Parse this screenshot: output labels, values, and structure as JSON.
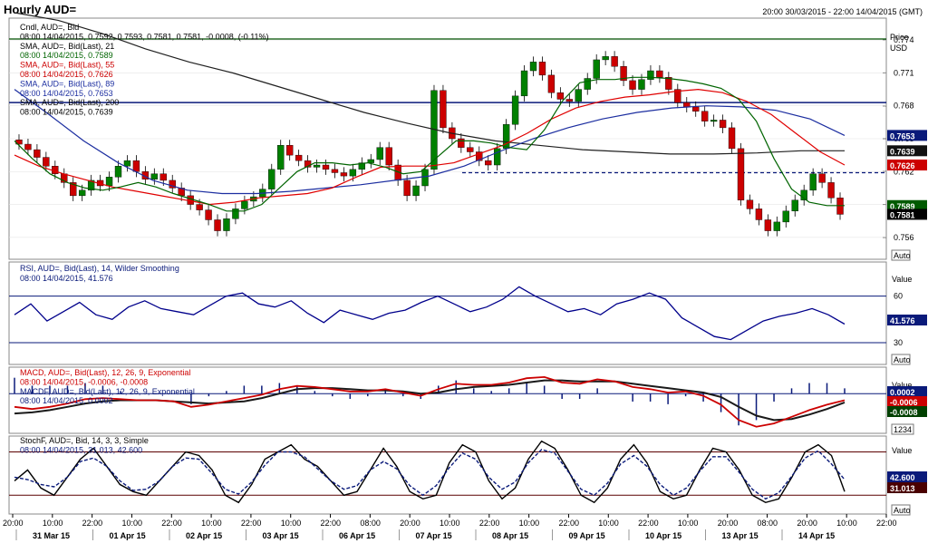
{
  "header": {
    "title": "Hourly AUD=",
    "range": "20:00 30/03/2015 - 22:00 14/04/2015 (GMT)"
  },
  "colors": {
    "bull": "#008000",
    "bear": "#cc0000",
    "sma21": "#006400",
    "sma55": "#e00000",
    "sma89": "#1c2ea0",
    "sma200": "#202020",
    "rsi": "#00008b",
    "navy": "#0a1a7a",
    "green_level": "#005000"
  },
  "price_panel": {
    "axis_title": "Price",
    "axis_unit": "USD",
    "legend": [
      {
        "text": "Cndl, AUD=, Bid",
        "color": "#000000"
      },
      {
        "text": "08:00 14/04/2015, 0.7592, 0.7593, 0.7581, 0.7581, -0.0008, (-0.11%)",
        "color": "#000000",
        "red_suffix": true
      },
      {
        "text": "SMA, AUD=, Bid(Last), 21",
        "color": "#000000"
      },
      {
        "text": "08:00 14/04/2015, 0.7589",
        "color": "#006400"
      },
      {
        "text": "SMA, AUD=, Bid(Last), 55",
        "color": "#cc0000"
      },
      {
        "text": "08:00 14/04/2015, 0.7626",
        "color": "#cc0000"
      },
      {
        "text": "SMA, AUD=, Bid(Last), 89",
        "color": "#1c2ea0"
      },
      {
        "text": "08:00 14/04/2015, 0.7653",
        "color": "#1c2ea0"
      },
      {
        "text": "SMA, AUD=, Bid(Last), 200",
        "color": "#000000"
      },
      {
        "text": "08:00 14/04/2015, 0.7639",
        "color": "#000000"
      }
    ],
    "ticks": [
      "0.774",
      "0.771",
      "0.768",
      "0.765",
      "0.762",
      "0.759",
      "0.756"
    ],
    "levels": {
      "resistance_1": 0.7741,
      "resistance_2": 0.7683,
      "dashed": 0.7619
    },
    "value_tags": [
      {
        "text": "0.7653",
        "value": 0.7653,
        "bg": "#0a1a7a"
      },
      {
        "text": "0.7639",
        "value": 0.7639,
        "bg": "#111111"
      },
      {
        "text": "0.7626",
        "value": 0.7626,
        "bg": "#cc0000"
      },
      {
        "text": "0.7589",
        "value": 0.7589,
        "bg": "#005a00"
      },
      {
        "text": "0.7581",
        "value": 0.7581,
        "bg": "#000000"
      }
    ],
    "auto_label": "Auto"
  },
  "rsi_panel": {
    "legend": [
      "RSI, AUD=, Bid(Last), 14, Wilder Smoothing",
      "08:00 14/04/2015, 41.576"
    ],
    "axis_title": "Value",
    "ticks": [
      "60",
      "30"
    ],
    "value_tag": "41.576",
    "auto_label": "Auto"
  },
  "macd_panel": {
    "legend": [
      {
        "text": "MACD, AUD=, Bid(Last), 12, 26, 9, Exponential",
        "color": "#cc0000"
      },
      {
        "text": "08:00 14/04/2015, -0.0006, -0.0008",
        "color": "#cc0000"
      },
      {
        "text": "MACDF, AUD=, Bid(Last), 12, 26, 9, Exponential",
        "color": "#0a1a7a"
      },
      {
        "text": "08:00 14/04/2015, 0.0002",
        "color": "#0a1a7a"
      }
    ],
    "axis_title": "Value",
    "ticks": [
      "0.0020",
      "-0.0020"
    ],
    "value_tags": [
      {
        "text": "0.0002",
        "bg": "#0a1a7a"
      },
      {
        "text": "-0.0006",
        "bg": "#cc0000"
      },
      {
        "text": "-0.0008",
        "bg": "#004000"
      }
    ],
    "scale_box": "1234"
  },
  "stoch_panel": {
    "legend": [
      "StochF, AUD=, Bid, 14, 3, 3, Simple",
      "08:00 14/04/2015, 31.013, 42.600"
    ],
    "axis_title": "Value",
    "ticks": [
      "80",
      "20"
    ],
    "value_tags": [
      {
        "text": "42.600",
        "bg": "#0a1a7a"
      },
      {
        "text": "31.013",
        "bg": "#4a0000"
      }
    ],
    "auto_label": "Auto"
  },
  "x_axis": {
    "times": [
      "20:00",
      "10:00",
      "22:00",
      "10:00",
      "22:00",
      "10:00",
      "22:00",
      "10:00",
      "22:00",
      "08:00",
      "20:00",
      "10:00",
      "22:00",
      "10:00",
      "22:00",
      "10:00",
      "22:00",
      "10:00",
      "20:00",
      "08:00",
      "20:00",
      "10:00",
      "22:00"
    ],
    "dates": [
      "31 Mar 15",
      "01 Apr 15",
      "02 Apr 15",
      "03 Apr 15",
      "06 Apr 15",
      "07 Apr 15",
      "08 Apr 15",
      "09 Apr 15",
      "10 Apr 15",
      "13 Apr 15",
      "14 Apr 15"
    ]
  },
  "chart_data": {
    "type": "line",
    "note_series": "close prices sampled along the hourly series",
    "price_close": [
      0.7645,
      0.764,
      0.7633,
      0.7625,
      0.7618,
      0.761,
      0.7598,
      0.7603,
      0.7612,
      0.7607,
      0.7615,
      0.7625,
      0.763,
      0.762,
      0.7613,
      0.7618,
      0.7612,
      0.7605,
      0.7598,
      0.759,
      0.7585,
      0.7576,
      0.7566,
      0.7577,
      0.7586,
      0.7593,
      0.7597,
      0.7604,
      0.7622,
      0.7644,
      0.7635,
      0.763,
      0.7624,
      0.7626,
      0.7622,
      0.7619,
      0.7616,
      0.7622,
      0.7628,
      0.7631,
      0.7642,
      0.7626,
      0.7612,
      0.7598,
      0.7607,
      0.7622,
      0.7694,
      0.766,
      0.765,
      0.7642,
      0.7638,
      0.763,
      0.7626,
      0.7641,
      0.7663,
      0.7689,
      0.7712,
      0.772,
      0.7708,
      0.7692,
      0.7686,
      0.7684,
      0.7695,
      0.7705,
      0.7722,
      0.7725,
      0.7716,
      0.7703,
      0.7695,
      0.7704,
      0.7712,
      0.7706,
      0.7695,
      0.7683,
      0.7679,
      0.7675,
      0.7666,
      0.7667,
      0.766,
      0.7641,
      0.7594,
      0.7586,
      0.7576,
      0.7566,
      0.7574,
      0.7584,
      0.7594,
      0.7603,
      0.7618,
      0.761,
      0.7596,
      0.7581
    ],
    "sma21": [
      0.7648,
      0.7632,
      0.7618,
      0.761,
      0.7605,
      0.7603,
      0.7606,
      0.761,
      0.7606,
      0.76,
      0.7595,
      0.759,
      0.7584,
      0.7584,
      0.759,
      0.7605,
      0.762,
      0.7628,
      0.7628,
      0.7626,
      0.7628,
      0.7624,
      0.7618,
      0.762,
      0.7634,
      0.7648,
      0.7648,
      0.7646,
      0.7642,
      0.764,
      0.7658,
      0.7684,
      0.7701,
      0.7704,
      0.7704,
      0.7706,
      0.7706,
      0.7705,
      0.7703,
      0.77,
      0.7696,
      0.7686,
      0.7666,
      0.7632,
      0.7604,
      0.7592,
      0.7589,
      0.7589
    ],
    "sma55": [
      0.7635,
      0.7625,
      0.7618,
      0.7612,
      0.7606,
      0.7602,
      0.7598,
      0.7594,
      0.759,
      0.7592,
      0.7596,
      0.7598,
      0.76,
      0.7605,
      0.7615,
      0.7624,
      0.7625,
      0.7625,
      0.7628,
      0.7636,
      0.7644,
      0.7655,
      0.7668,
      0.7678,
      0.7684,
      0.7688,
      0.769,
      0.7693,
      0.7695,
      0.7692,
      0.7684,
      0.7672,
      0.7655,
      0.7638,
      0.7626
    ],
    "sma89": [
      0.7695,
      0.7672,
      0.7648,
      0.7628,
      0.7612,
      0.7603,
      0.76,
      0.76,
      0.7602,
      0.7605,
      0.7608,
      0.7612,
      0.7616,
      0.7625,
      0.7638,
      0.765,
      0.766,
      0.7668,
      0.7674,
      0.7678,
      0.768,
      0.7679,
      0.7676,
      0.7668,
      0.7653
    ],
    "sma200": [
      0.7765,
      0.7758,
      0.7746,
      0.7732,
      0.772,
      0.771,
      0.7698,
      0.7686,
      0.7674,
      0.7664,
      0.7655,
      0.7648,
      0.7644,
      0.764,
      0.7638,
      0.7636,
      0.7636,
      0.7637,
      0.7639,
      0.7639
    ],
    "rsi": [
      48,
      55,
      44,
      50,
      56,
      48,
      45,
      53,
      57,
      52,
      50,
      48,
      54,
      60,
      62,
      55,
      53,
      57,
      49,
      43,
      51,
      48,
      45,
      49,
      51,
      56,
      60,
      55,
      50,
      53,
      58,
      66,
      60,
      55,
      50,
      52,
      48,
      55,
      58,
      62,
      58,
      46,
      40,
      34,
      32,
      38,
      44,
      47,
      49,
      52,
      48,
      42
    ],
    "rsi_levels": [
      60,
      30
    ],
    "macd": [
      -0.0012,
      -0.0014,
      -0.0012,
      -0.0009,
      -0.0005,
      -0.0004,
      -0.0005,
      -0.0006,
      -0.0006,
      -0.0007,
      -0.0012,
      -0.001,
      -0.0007,
      -0.0004,
      -0.0001,
      0.0004,
      0.0007,
      0.0006,
      0.0004,
      0.0002,
      0.0002,
      0.0004,
      0.0001,
      -0.0002,
      0.0004,
      0.0009,
      0.0008,
      0.0008,
      0.001,
      0.0014,
      0.0015,
      0.001,
      0.0009,
      0.0013,
      0.0011,
      0.0006,
      0.0004,
      0.0001,
      0.0002,
      -0.0002,
      -0.001,
      -0.0024,
      -0.003,
      -0.0027,
      -0.0021,
      -0.0015,
      -0.001,
      -0.0006
    ],
    "macd_signal": [
      -0.0018,
      -0.0017,
      -0.0015,
      -0.0012,
      -0.0009,
      -0.0007,
      -0.0006,
      -0.0006,
      -0.0006,
      -0.0007,
      -0.0008,
      -0.0009,
      -0.0008,
      -0.0007,
      -0.0004,
      0.0,
      0.0004,
      0.0005,
      0.0005,
      0.0004,
      0.0003,
      0.0003,
      0.0002,
      0.0,
      0.0001,
      0.0004,
      0.0006,
      0.0007,
      0.0008,
      0.001,
      0.0012,
      0.0012,
      0.0011,
      0.0011,
      0.0011,
      0.0009,
      0.0007,
      0.0005,
      0.0003,
      0.0001,
      -0.0003,
      -0.0012,
      -0.002,
      -0.0024,
      -0.0023,
      -0.0019,
      -0.0014,
      -0.0008
    ],
    "stoch_k": [
      40,
      55,
      30,
      20,
      45,
      70,
      85,
      60,
      35,
      25,
      20,
      40,
      60,
      80,
      75,
      55,
      20,
      10,
      35,
      70,
      80,
      90,
      70,
      60,
      40,
      20,
      25,
      55,
      85,
      60,
      25,
      15,
      20,
      65,
      90,
      80,
      40,
      15,
      30,
      70,
      95,
      85,
      55,
      20,
      10,
      30,
      70,
      90,
      65,
      25,
      15,
      20,
      55,
      85,
      80,
      55,
      20,
      10,
      15,
      45,
      80,
      90,
      75,
      25
    ],
    "stoch_levels": [
      80,
      20
    ]
  }
}
